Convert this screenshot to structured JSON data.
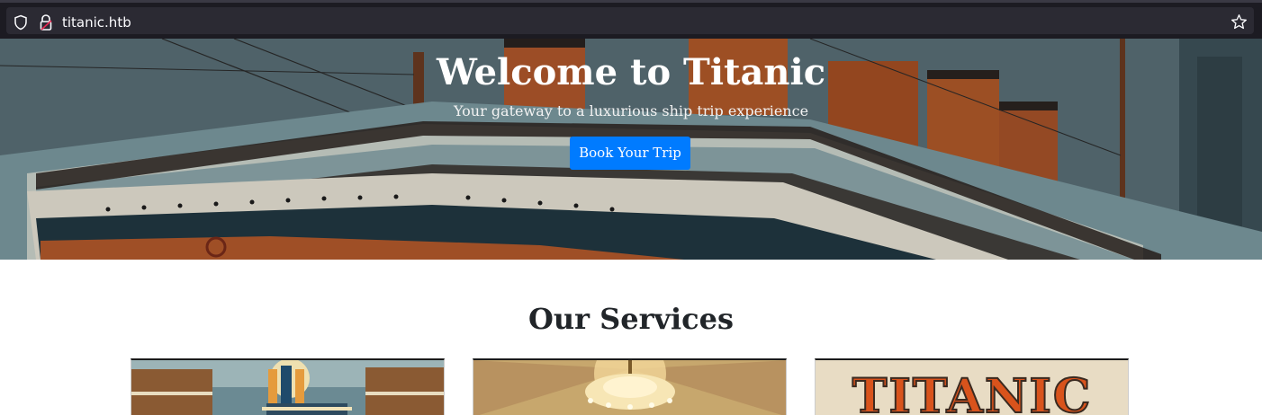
{
  "browser": {
    "url": "titanic.htb",
    "icons": [
      "shield-icon",
      "lock-icon",
      "star-icon"
    ]
  },
  "hero": {
    "title": "Welcome to Titanic",
    "subtitle": "Your gateway to a luxurious ship trip experience",
    "button_label": "Book Your Trip"
  },
  "services": {
    "title": "Our Services",
    "cards": [
      {
        "image": "ship-deck-illustration"
      },
      {
        "image": "chandelier-hall-illustration"
      },
      {
        "image": "titanic-poster-illustration",
        "poster_text": "TITANIC"
      }
    ]
  },
  "colors": {
    "accent": "#007bff",
    "heading": "#212529",
    "chrome": "#1c1b22"
  }
}
